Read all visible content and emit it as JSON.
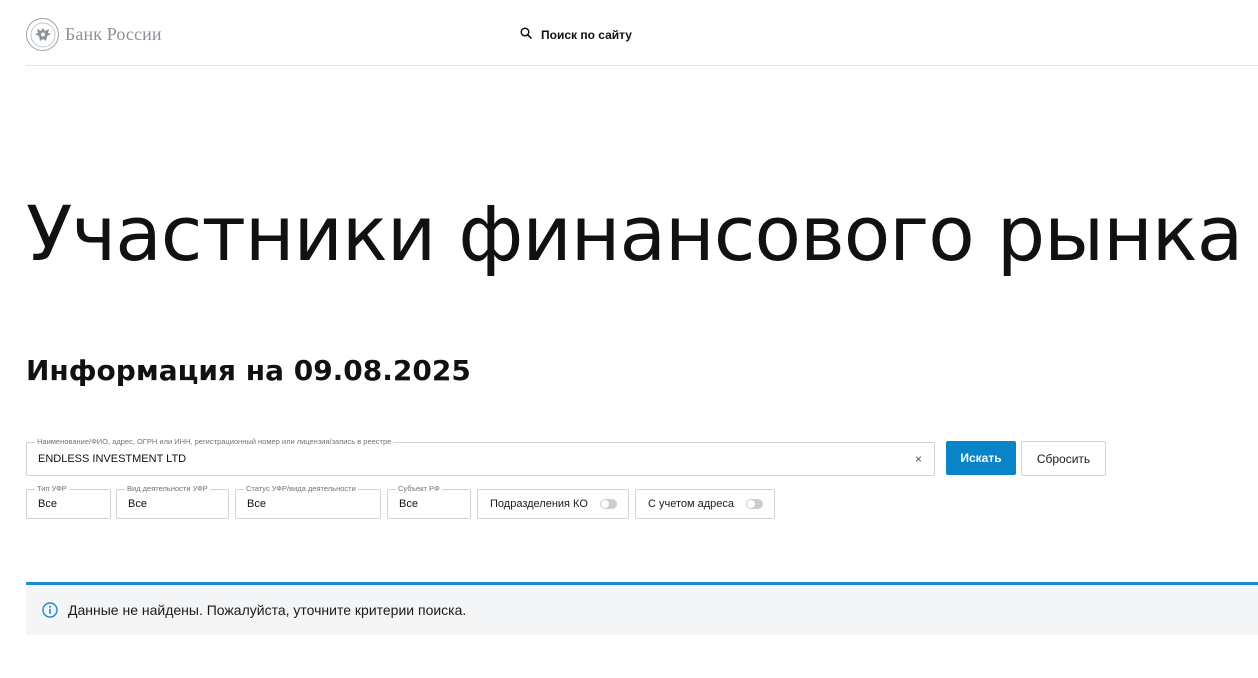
{
  "header": {
    "logo_text": "Банк России",
    "site_search_label": "Поиск по сайту"
  },
  "page_title": "Участники финансового рынка",
  "subtitle": "Информация на 09.08.2025",
  "search": {
    "legend": "Наименование/ФИО, адрес, ОГРН или ИНН, регистрационный номер или лицензия/запись в реестре",
    "value": "ENDLESS INVESTMENT LTD",
    "clear_symbol": "×",
    "submit_label": "Искать",
    "reset_label": "Сбросить"
  },
  "filters": [
    {
      "legend": "Тип УФР",
      "value": "Все"
    },
    {
      "legend": "Вид деятельности УФР",
      "value": "Все"
    },
    {
      "legend": "Статус УФР/вида деятельности",
      "value": "Все"
    },
    {
      "legend": "Субъект РФ",
      "value": "Все"
    }
  ],
  "toggles": [
    {
      "label": "Подразделения КО",
      "on": false
    },
    {
      "label": "С учетом адреса",
      "on": false
    }
  ],
  "alert": {
    "text": "Данные не найдены. Пожалуйста, уточните критерии поиска."
  },
  "colors": {
    "accent": "#0a84c9",
    "alert_border": "#1b8ad0",
    "alert_bg": "#f4f5f6"
  }
}
